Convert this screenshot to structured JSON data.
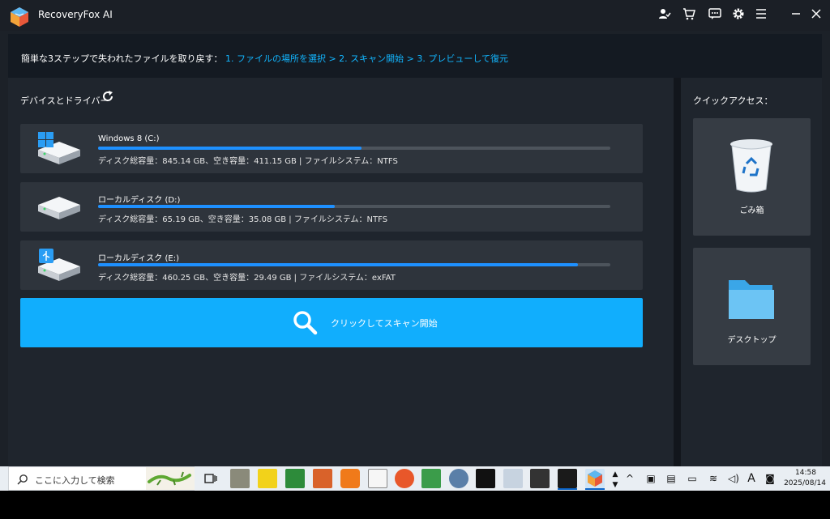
{
  "window": {
    "title": "RecoveryFox AI",
    "accent": "#11aefd"
  },
  "titlebar_icons": [
    "user-check-icon",
    "cart-icon",
    "chat-icon",
    "gear-icon",
    "menu-icon",
    "minimize-icon",
    "close-icon"
  ],
  "banner": {
    "lead": "簡単な3ステップで失われたファイルを取り戻す：",
    "steps": "1. ファイルの場所を選択 > 2. スキャン開始 > 3. プレビューして復元"
  },
  "devices": {
    "title": "デバイスとドライバー",
    "drives": [
      {
        "name": "Windows 8 (C:)",
        "info": "ディスク総容量：845.14 GB、空き容量：411.15 GB | ファイルシステム：NTFS",
        "used_fraction": 0.514,
        "icon": "windows-drive-icon"
      },
      {
        "name": "ローカルディスク (D:)",
        "info": "ディスク総容量：65.19 GB、空き容量：35.08 GB | ファイルシステム：NTFS",
        "used_fraction": 0.462,
        "icon": "hard-drive-icon"
      },
      {
        "name": "ローカルディスク (E:)",
        "info": "ディスク総容量：460.25 GB、空き容量：29.49 GB | ファイルシステム：exFAT",
        "used_fraction": 0.936,
        "icon": "usb-drive-icon"
      }
    ]
  },
  "scan_button": {
    "label": "クリックしてスキャン開始"
  },
  "quick_access": {
    "title": "クイックアクセス：",
    "items": [
      {
        "label": "ごみ箱",
        "icon": "recycle-bin-icon"
      },
      {
        "label": "デスクトップ",
        "icon": "folder-icon"
      }
    ]
  },
  "taskbar": {
    "search_placeholder": "ここに入力して検索",
    "time": "14:58",
    "date": "2025/08/14",
    "ime": "A"
  }
}
